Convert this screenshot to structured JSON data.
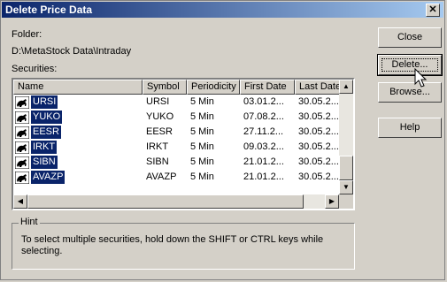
{
  "window": {
    "title": "Delete Price Data"
  },
  "folder": {
    "label": "Folder:",
    "path": "D:\\MetaStock Data\\Intraday"
  },
  "securities": {
    "label": "Securities:",
    "columns": [
      "Name",
      "Symbol",
      "Periodicity",
      "First Date",
      "Last Date"
    ],
    "rows": [
      {
        "name": "URSI",
        "symbol": "URSI",
        "periodicity": "5 Min",
        "first": "03.01.2...",
        "last": "30.05.2..."
      },
      {
        "name": "YUKO",
        "symbol": "YUKO",
        "periodicity": "5 Min",
        "first": "07.08.2...",
        "last": "30.05.2..."
      },
      {
        "name": "EESR",
        "symbol": "EESR",
        "periodicity": "5 Min",
        "first": "27.11.2...",
        "last": "30.05.2..."
      },
      {
        "name": "IRKT",
        "symbol": "IRKT",
        "periodicity": "5 Min",
        "first": "09.03.2...",
        "last": "30.05.2..."
      },
      {
        "name": "SIBN",
        "symbol": "SIBN",
        "periodicity": "5 Min",
        "first": "21.01.2...",
        "last": "30.05.2..."
      },
      {
        "name": "AVAZP",
        "symbol": "AVAZP",
        "periodicity": "5 Min",
        "first": "21.01.2...",
        "last": "30.05.2..."
      }
    ],
    "row_icon": "bull-icon",
    "selection_color": "#0a246a"
  },
  "hint": {
    "title": "Hint",
    "text": "To select multiple securities, hold down the SHIFT or CTRL keys while selecting."
  },
  "buttons": {
    "close": "Close",
    "delete": "Delete...",
    "browse": "Browse...",
    "help": "Help"
  },
  "title_close": "✕"
}
